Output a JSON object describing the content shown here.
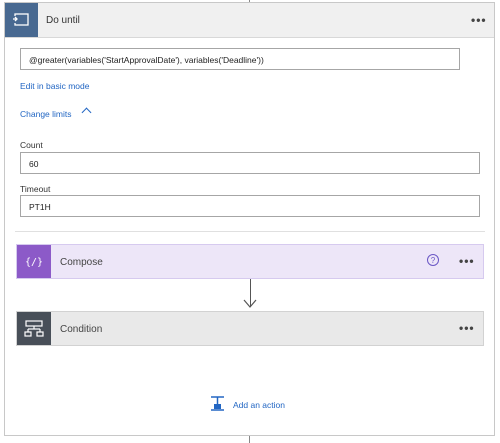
{
  "loop": {
    "title": "Do until",
    "more_label": "•••",
    "condition_expression": "@greater(variables('StartApprovalDate'), variables('Deadline'))",
    "edit_basic_label": "Edit in basic mode",
    "change_limits_label": "Change limits",
    "count_label": "Count",
    "count_value": "60",
    "timeout_label": "Timeout",
    "timeout_value": "PT1H"
  },
  "compose": {
    "title": "Compose",
    "help_label": "?",
    "more_label": "•••",
    "icon_glyph": "{ }"
  },
  "condition": {
    "title": "Condition",
    "more_label": "•••"
  },
  "add_action": {
    "label": "Add an action"
  },
  "colors": {
    "loop_header_icon": "#486991",
    "compose_accent": "#8c5ac8",
    "condition_accent": "#484f58",
    "link": "#2266c3"
  }
}
